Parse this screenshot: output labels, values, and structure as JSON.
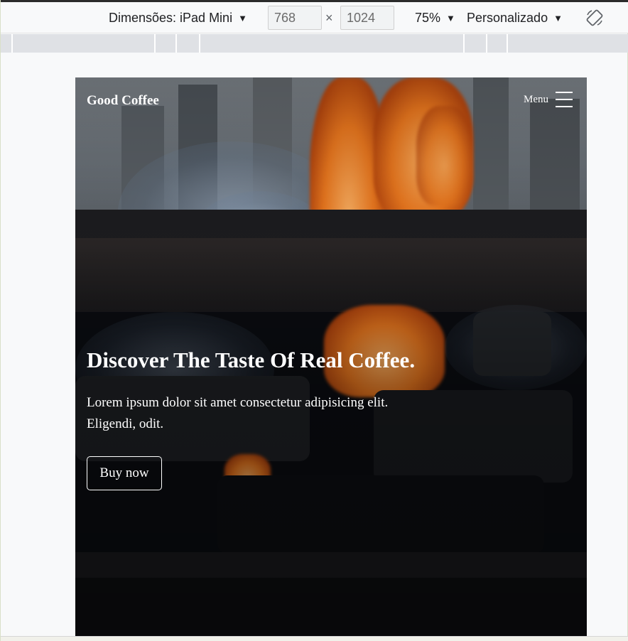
{
  "toolbar": {
    "dimensions_label": "Dimensões: iPad Mini",
    "width_value": "768",
    "height_value": "1024",
    "times_symbol": "×",
    "zoom_label": "75%",
    "throttle_label": "Personalizado",
    "caret": "▼",
    "rotate_icon": "rotate-icon"
  },
  "site": {
    "brand": "Good Coffee",
    "menu_label": "Menu",
    "menu_icon": "hamburger-icon",
    "hero": {
      "headline": "Discover The Taste Of Real Coffee.",
      "lead": "Lorem ipsum dolor sit amet consectetur adipisicing elit. Eligendi, odit.",
      "cta_label": "Buy now"
    }
  },
  "colors": {
    "text": "#ffffff",
    "toolbar_bg": "#f8f9fa",
    "ruler_bg": "#dfe1e5",
    "flame": "#ef7a1f"
  }
}
